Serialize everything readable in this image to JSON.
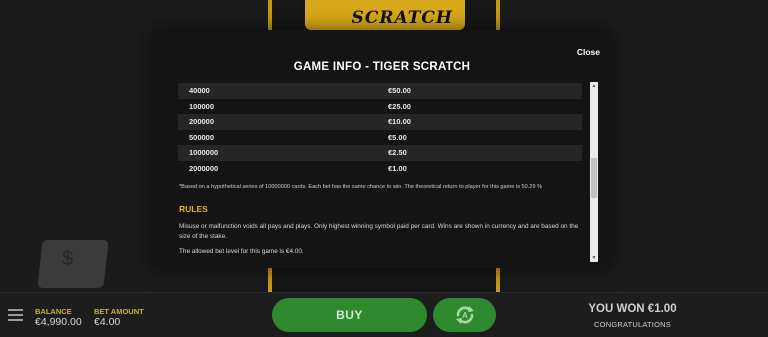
{
  "background": {
    "logo_text": "SCRATCH"
  },
  "modal": {
    "close_label": "Close",
    "title": "GAME INFO - TIGER SCRATCH",
    "paytable": [
      {
        "chance": "40000",
        "prize": "€50.00"
      },
      {
        "chance": "100000",
        "prize": "€25.00"
      },
      {
        "chance": "200000",
        "prize": "€10.00"
      },
      {
        "chance": "500000",
        "prize": "€5.00"
      },
      {
        "chance": "1000000",
        "prize": "€2.50"
      },
      {
        "chance": "2000000",
        "prize": "€1.00"
      }
    ],
    "footnote": "*Based on a hypothetical series of 10000000 cards. Each bet has the same chance to win. The theoretical return to player for this game is 50.29 %",
    "rules_heading": "RULES",
    "rules_text": "Misuse or malfunction voids all pays and plays. Only highest winning symbol paid per card. Wins are shown in currency and are based on the size of the stake.",
    "rules_bet": "The allowed bet level for this game is €4.00."
  },
  "bottom_bar": {
    "balance_label": "BALANCE",
    "balance_value": "€4,990.00",
    "bet_label": "BET AMOUNT",
    "bet_value": "€4.00",
    "buy_label": "BUY",
    "won_text": "YOU WON €1.00",
    "won_sub": "CONGRATULATIONS"
  },
  "colors": {
    "accent_gold": "#e4b22a",
    "button_green": "#2f8a2f",
    "label_yellow": "#c8b23a"
  },
  "icons": {
    "menu": "hamburger-menu-icon",
    "autoplay": "autoplay-icon",
    "card_symbol": "dollar-icon"
  }
}
